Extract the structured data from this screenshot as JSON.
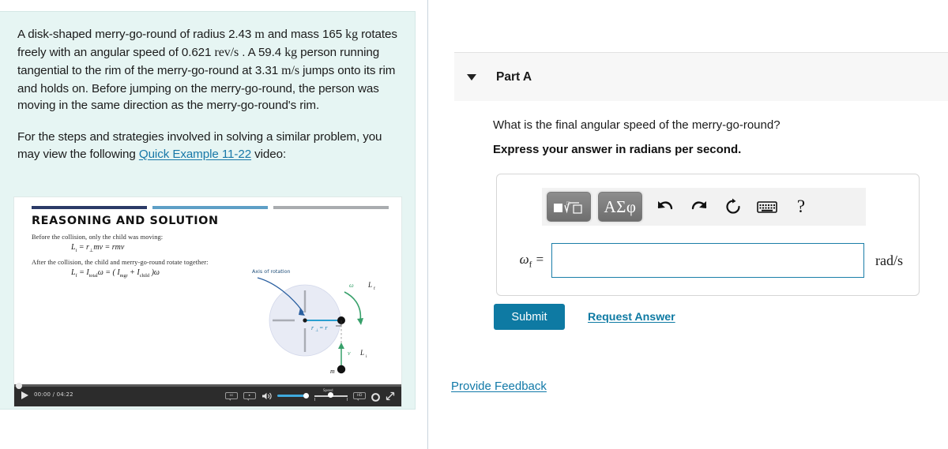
{
  "problem": {
    "statement_parts": [
      "A disk-shaped merry-go-round of radius 2.43 ",
      "m",
      " and mass 165 ",
      "kg",
      " rotates freely with an angular speed of 0.621 ",
      "rev/s",
      " . A 59.4 ",
      "kg",
      " person running tangential to the rim of the merry-go-round at 3.31 ",
      "m/s",
      " jumps onto its rim and holds on. Before jumping on the merry-go-round, the person was moving in the same direction as the merry-go-round's rim."
    ],
    "radius": "2.43",
    "radius_unit": "m",
    "mass": "165",
    "mass_unit": "kg",
    "angular_speed": "0.621",
    "angular_speed_unit": "rev/s",
    "person_mass": "59.4",
    "person_mass_unit": "kg",
    "person_speed": "3.31",
    "person_speed_unit": "m/s",
    "video_intro_before": "For the steps and strategies involved in solving a similar problem, you may view the following ",
    "video_link_text": "Quick Example 11-22",
    "video_intro_after": " video:"
  },
  "video": {
    "slide_title": "REASONING AND SOLUTION",
    "line1": "Before the collision, only the child was moving:",
    "line2": "After the collision, the child and merry-go-round rotate together:",
    "equation1": "Lᵢ = r⊥mv = rmv",
    "equation2": "L_f = I_total ω = (I_mgr + I_child)ω",
    "diagram": {
      "axis_label": "Axis of rotation",
      "omega_label": "ω",
      "lf_label": "L_f",
      "li_label": "Lᵢ",
      "r_label": "r⊥ = r",
      "v_label": "v",
      "m_label": "m"
    },
    "controls": {
      "play_label": "play-button",
      "time": "00:00 / 04:22",
      "cc_label": "cc",
      "hd_label": "HD",
      "speed_label": "Speed",
      "settings_label": "settings",
      "fullscreen_label": "fullscreen"
    }
  },
  "part": {
    "title": "Part A",
    "question": "What is the final angular speed of the merry-go-round?",
    "instruction": "Express your answer in radians per second."
  },
  "answer": {
    "variable": "ω",
    "variable_sub": "f",
    "equals": "=",
    "value": "",
    "placeholder": "",
    "unit": "rad/s",
    "toolbar": {
      "templates_label": "math-templates",
      "greek_label": "ΑΣφ",
      "undo_label": "undo",
      "redo_label": "redo",
      "reset_label": "reset",
      "keyboard_label": "keyboard",
      "help_label": "?"
    }
  },
  "actions": {
    "submit_label": "Submit",
    "request_answer_label": "Request Answer",
    "provide_feedback_label": "Provide Feedback"
  },
  "colors": {
    "panel_bg": "#e6f5f3",
    "link": "#1179a8",
    "accent": "#0e7aa3",
    "input_border": "#1a7ea8"
  }
}
